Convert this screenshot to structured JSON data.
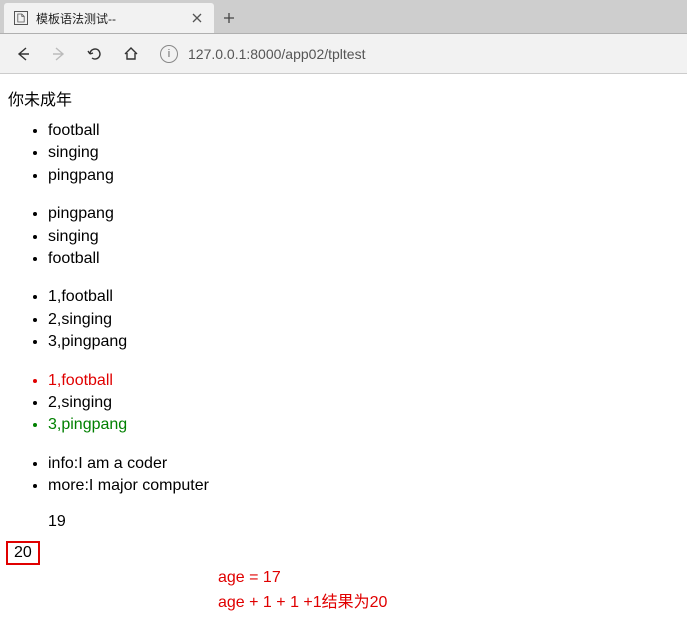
{
  "tab": {
    "title": "模板语法测试--"
  },
  "url": "127.0.0.1:8000/app02/tpltest",
  "heading": "你未成年",
  "list1": [
    "football",
    "singing",
    "pingpang"
  ],
  "list2": [
    "pingpang",
    "singing",
    "football"
  ],
  "list3": [
    "1,football",
    "2,singing",
    "3,pingpang"
  ],
  "list4": [
    {
      "text": "1,football",
      "cls": "red"
    },
    {
      "text": "2,singing",
      "cls": ""
    },
    {
      "text": "3,pingpang",
      "cls": "green"
    }
  ],
  "list5": [
    "info:I am a coder",
    "more:I major computer"
  ],
  "indent_num": "19",
  "boxed_num": "20",
  "annot1": "age = 17",
  "annot2": "age + 1 + 1 +1结果为20"
}
